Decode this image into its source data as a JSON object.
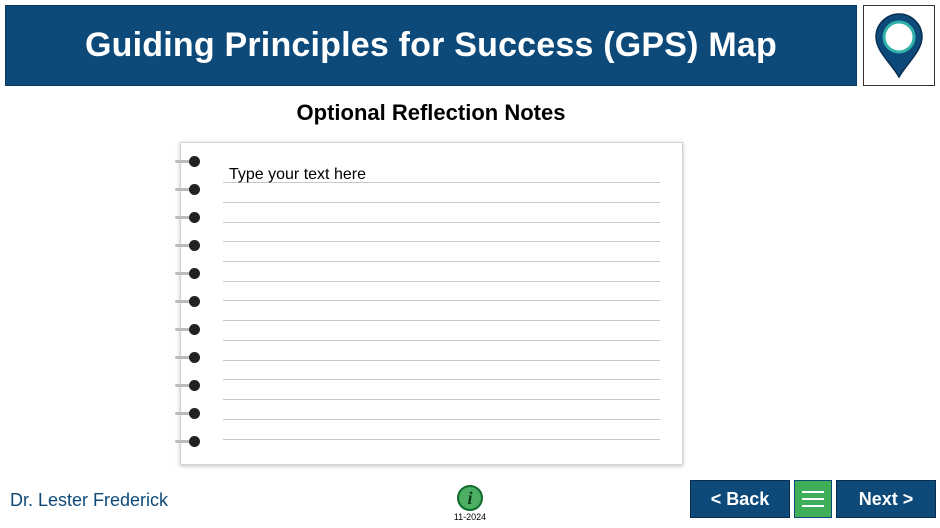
{
  "header": {
    "title": "Guiding Principles for Success (GPS) Map",
    "icon": "map-pin-icon",
    "color": "#0d4a7a"
  },
  "notes": {
    "title": "Optional Reflection Notes",
    "placeholder": "Type your text here",
    "value": ""
  },
  "footer": {
    "author": "Dr. Lester Frederick",
    "info_icon": "info-icon",
    "date": "11-2024",
    "back_label": "< Back",
    "menu_icon": "hamburger-menu-icon",
    "next_label": "Next >",
    "accent": "#3fae58"
  }
}
